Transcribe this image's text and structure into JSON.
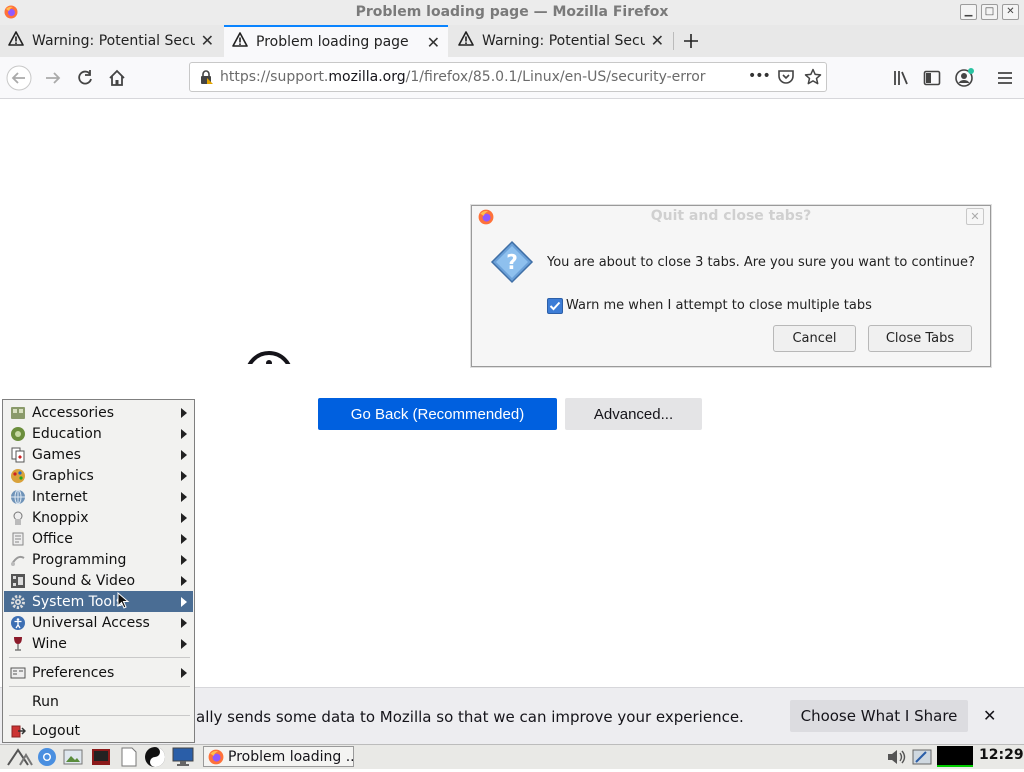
{
  "window": {
    "title": "Problem loading page — Mozilla Firefox"
  },
  "tabs": [
    {
      "label": "Warning: Potential Security Risk Ahead",
      "active": false
    },
    {
      "label": "Problem loading page",
      "active": true
    },
    {
      "label": "Warning: Potential Security Risk Ahead",
      "active": false
    }
  ],
  "navbar": {
    "url_prefix": "https://support.",
    "url_domain": "mozilla.org",
    "url_path": "/1/firefox/85.0.1/Linux/en-US/security-error",
    "page_actions": "•••"
  },
  "page": {
    "go_back_label": "Go Back (Recommended)",
    "advanced_label": "Advanced..."
  },
  "dialog": {
    "title": "Quit and close tabs?",
    "message": "You are about to close 3 tabs. Are you sure you want to continue?",
    "checkbox_label": "Warn me when I attempt to close multiple tabs",
    "checkbox_checked": true,
    "cancel_label": "Cancel",
    "close_tabs_label": "Close Tabs"
  },
  "notification": {
    "text": "ally sends some data to Mozilla so that we can improve your experience.",
    "choose_label": "Choose What I Share",
    "close_glyph": "✕"
  },
  "start_menu": {
    "items": [
      {
        "label": "Accessories",
        "submenu": true
      },
      {
        "label": "Education",
        "submenu": true
      },
      {
        "label": "Games",
        "submenu": true
      },
      {
        "label": "Graphics",
        "submenu": true
      },
      {
        "label": "Internet",
        "submenu": true
      },
      {
        "label": "Knoppix",
        "submenu": true
      },
      {
        "label": "Office",
        "submenu": true
      },
      {
        "label": "Programming",
        "submenu": true
      },
      {
        "label": "Sound & Video",
        "submenu": true
      },
      {
        "label": "System Tools",
        "submenu": true,
        "highlighted": true
      },
      {
        "label": "Universal Access",
        "submenu": true
      },
      {
        "label": "Wine",
        "submenu": true
      }
    ],
    "preferences_label": "Preferences",
    "run_label": "Run",
    "logout_label": "Logout"
  },
  "taskbar": {
    "window_button_label": "Problem loading ...",
    "clock": "12:29"
  },
  "colors": {
    "accent": "#0060df",
    "menu_highlight": "#4a6d94",
    "tab_active_line": "#0a84ff"
  }
}
